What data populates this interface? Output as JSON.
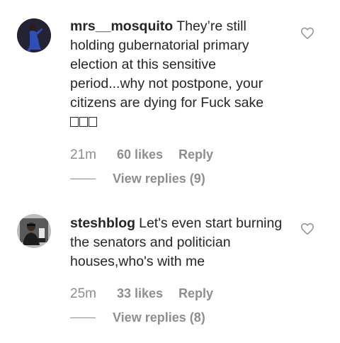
{
  "comments": [
    {
      "username": "mrs__mosquito",
      "text": "They’re still holding gubernatorial primary election at this sensitive period...why not postpone, your citizens are dying for Fuck sake",
      "time": "21m",
      "likes": "60 likes",
      "reply_label": "Reply",
      "view_replies": "View replies (9)",
      "heart_icon": "heart-outline-icon",
      "avatar_colors": {
        "bg": "#1f1f2b",
        "figure": "#2f4fb8"
      }
    },
    {
      "username": "steshblog",
      "text": "Let's even start burning the senators and politician houses,who's with me",
      "time": "25m",
      "likes": "33 likes",
      "reply_label": "Reply",
      "view_replies": "View replies (8)",
      "heart_icon": "heart-outline-icon",
      "avatar_colors": {
        "bg": "#4a4a4a",
        "figure": "#d9d9d9"
      }
    }
  ],
  "colors": {
    "text": "#262626",
    "secondary": "#8e8e8e"
  }
}
